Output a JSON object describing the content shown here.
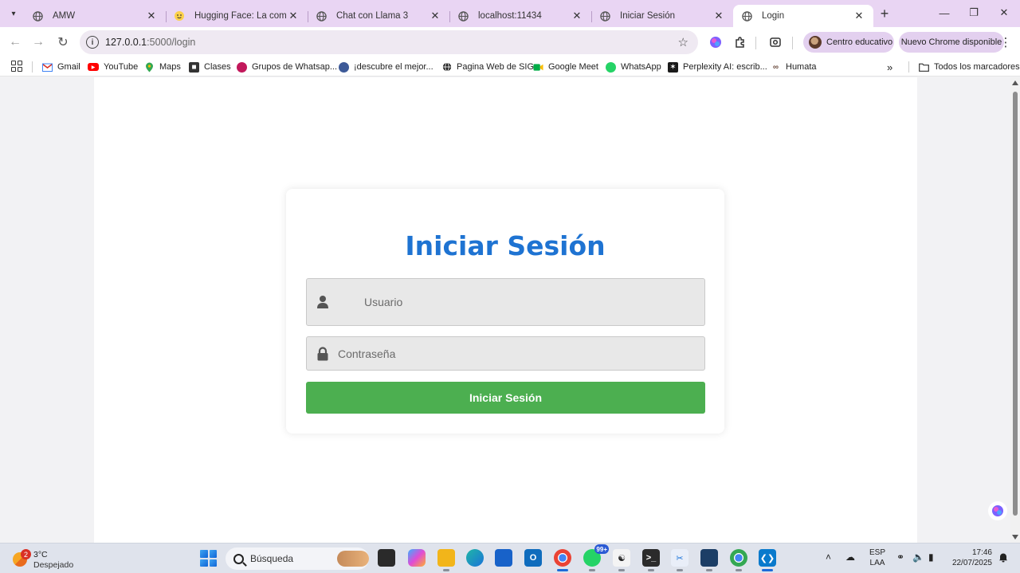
{
  "browser": {
    "tabs": [
      {
        "title": "AMW",
        "active": false
      },
      {
        "title": "Hugging Face: La comunidad",
        "active": false
      },
      {
        "title": "Chat con Llama 3",
        "active": false
      },
      {
        "title": "localhost:11434",
        "active": false
      },
      {
        "title": "Iniciar Sesión",
        "active": false
      },
      {
        "title": "Login",
        "active": true
      }
    ],
    "address": {
      "host": "127.0.0.1",
      "path": ":5000/login"
    },
    "profile_label": "Centro educativo",
    "update_label": "Nuevo Chrome disponible",
    "bookmarks": [
      {
        "label": "Gmail",
        "icon": "gmail-icon"
      },
      {
        "label": "YouTube",
        "icon": "youtube-icon"
      },
      {
        "label": "Maps",
        "icon": "maps-icon"
      },
      {
        "label": "Clases",
        "icon": "classroom-icon"
      },
      {
        "label": "Grupos de Whatsap...",
        "icon": "groups-icon"
      },
      {
        "label": "¡descubre el mejor...",
        "icon": "globe-icon"
      },
      {
        "label": "Pagina Web de SIG",
        "icon": "globe-icon"
      },
      {
        "label": "Google Meet",
        "icon": "meet-icon"
      },
      {
        "label": "WhatsApp",
        "icon": "whatsapp-icon"
      },
      {
        "label": "Perplexity AI: escrib...",
        "icon": "perplexity-icon"
      },
      {
        "label": "Humata",
        "icon": "humata-icon"
      }
    ],
    "all_bookmarks_label": "Todos los marcadores"
  },
  "login": {
    "title": "Iniciar Sesión",
    "username_placeholder": "Usuario",
    "password_placeholder": "Contraseña",
    "submit_label": "Iniciar Sesión"
  },
  "taskbar": {
    "weather_badge": "2",
    "temperature": "3°C",
    "condition": "Despejado",
    "search_label": "Búsqueda",
    "whatsapp_badge": "99+",
    "language_top": "ESP",
    "language_bottom": "LAA",
    "time": "17:46",
    "date": "22/07/2025"
  },
  "colors": {
    "title_blue": "#1e73d2",
    "submit_green": "#4caf50",
    "tabstrip": "#e9d5f3"
  }
}
